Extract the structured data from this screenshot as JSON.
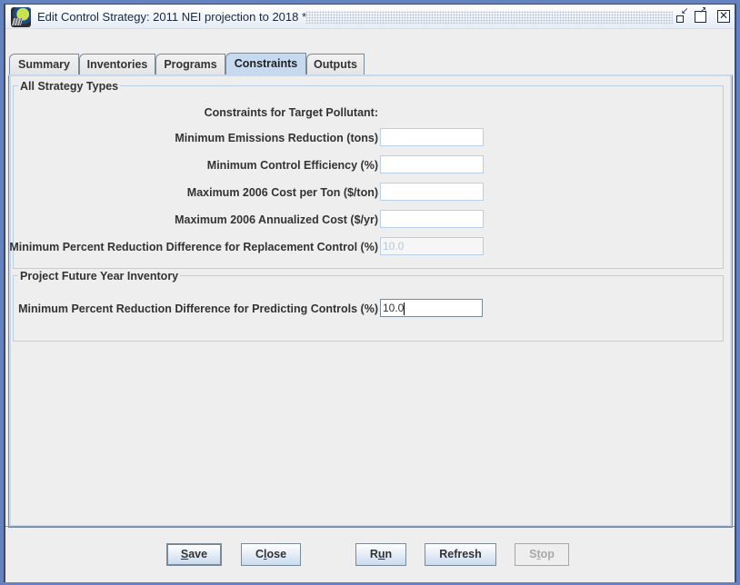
{
  "window": {
    "title": "Edit Control Strategy: 2011 NEI projection to 2018 *",
    "controls": {
      "iconify": "iconify-icon",
      "maximize": "maximize-icon",
      "close": "close-icon"
    }
  },
  "tabs": [
    {
      "label": "Summary",
      "active": false
    },
    {
      "label": "Inventories",
      "active": false
    },
    {
      "label": "Programs",
      "active": false
    },
    {
      "label": "Constraints",
      "active": true
    },
    {
      "label": "Outputs",
      "active": false
    }
  ],
  "all_strategy_types": {
    "title": "All Strategy Types",
    "header": "Constraints for Target Pollutant:",
    "fields": [
      {
        "label": "Minimum Emissions Reduction (tons)",
        "value": "",
        "enabled": true
      },
      {
        "label": "Minimum Control Efficiency (%)",
        "value": "",
        "enabled": true
      },
      {
        "label": "Maximum 2006 Cost per Ton ($/ton)",
        "value": "",
        "enabled": true
      },
      {
        "label": "Maximum 2006 Annualized Cost ($/yr)",
        "value": "",
        "enabled": true
      },
      {
        "label": "Minimum Percent Reduction Difference for Replacement Control (%)",
        "value": "10.0",
        "enabled": false
      }
    ]
  },
  "project_future_year": {
    "title": "Project Future Year Inventory",
    "fields": [
      {
        "label": "Minimum Percent Reduction Difference for Predicting Controls (%)",
        "value": "10.0",
        "enabled": true,
        "focused": true
      }
    ]
  },
  "buttons": {
    "save": {
      "pre": "",
      "mnemonic": "S",
      "post": "ave",
      "enabled": true,
      "default": true
    },
    "close": {
      "pre": "C",
      "mnemonic": "l",
      "post": "ose",
      "enabled": true
    },
    "run": {
      "pre": "R",
      "mnemonic": "u",
      "post": "n",
      "enabled": true
    },
    "refresh": {
      "pre": "Refresh",
      "mnemonic": "",
      "post": "",
      "enabled": true
    },
    "stop": {
      "pre": "S",
      "mnemonic": "t",
      "post": "op",
      "enabled": false
    }
  },
  "colors": {
    "frame": "#6382bf",
    "active_tab": "#c6d9ef",
    "field_border": "#b8cfe5",
    "panel_bg": "#eeeeee"
  }
}
